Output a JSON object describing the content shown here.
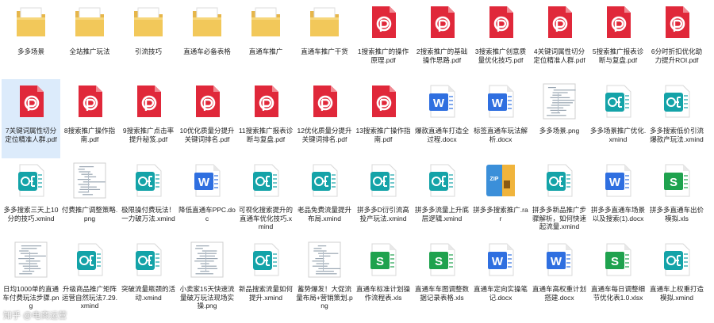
{
  "files": [
    {
      "type": "folder",
      "label": "多多场景"
    },
    {
      "type": "folder",
      "label": "全站推广玩法"
    },
    {
      "type": "folder",
      "label": "引流技巧"
    },
    {
      "type": "folder",
      "label": "直通车必备表格"
    },
    {
      "type": "folder",
      "label": "直通车推广"
    },
    {
      "type": "folder",
      "label": "直通车推广干货"
    },
    {
      "type": "pdf",
      "label": "1搜索推广的操作原理.pdf"
    },
    {
      "type": "pdf",
      "label": "2搜索推广的基础操作思路.pdf"
    },
    {
      "type": "pdf",
      "label": "3搜索推广创意质量优化技巧.pdf"
    },
    {
      "type": "pdf",
      "label": "4关键词属性切分定位精准人群.pdf"
    },
    {
      "type": "pdf",
      "label": "5搜索推广报表诊断与复盘.pdf"
    },
    {
      "type": "pdf",
      "label": "6分时折扣优化助力提升ROI.pdf"
    },
    {
      "type": "pdf",
      "label": "7关键词属性切分定位精准人群.pdf",
      "selected": true
    },
    {
      "type": "pdf",
      "label": "8搜索推广操作指南.pdf"
    },
    {
      "type": "pdf",
      "label": "9搜索推广点击率提升秘笈.pdf"
    },
    {
      "type": "pdf",
      "label": "10优化质量分提升关键词排名.pdf"
    },
    {
      "type": "pdf",
      "label": "11搜索推广报表诊断与复盘.pdf"
    },
    {
      "type": "pdf",
      "label": "12优化质量分提升关键词排名.pdf"
    },
    {
      "type": "pdf",
      "label": "13搜索推广操作指南.pdf"
    },
    {
      "type": "docx",
      "label": "爆款直通车打造全过程.docx"
    },
    {
      "type": "docx",
      "label": "标签直通车玩法解析.docx"
    },
    {
      "type": "png",
      "label": "多多场景.png"
    },
    {
      "type": "xmind",
      "label": "多多场景推广优化.xmind"
    },
    {
      "type": "xmind",
      "label": "多多搜索低价引流爆款产玩法.xmind"
    },
    {
      "type": "xmind",
      "label": "多多搜索三天上10分的技巧.xmind"
    },
    {
      "type": "png",
      "label": "付费推广调整策略.png"
    },
    {
      "type": "xmind",
      "label": "极限操付费玩法！一力破万法.xmind"
    },
    {
      "type": "docx",
      "label": "降低直通车PPC.doc"
    },
    {
      "type": "xmind",
      "label": "可视化搜索提升的直通车优化技巧.xmind"
    },
    {
      "type": "xmind",
      "label": "老品免费流量提升布局.xmind"
    },
    {
      "type": "xmind",
      "label": "拼多多D衍引流高投产玩法.xmind"
    },
    {
      "type": "xmind",
      "label": "拼多多流量上升底层逻辑.xmind"
    },
    {
      "type": "rar",
      "label": "拼多多搜索推广.rar"
    },
    {
      "type": "xmind",
      "label": "拼多多新品推广步骤解析，如何快速起流量.xmind"
    },
    {
      "type": "docx",
      "label": "拼多多直通车场景以及搜索(1).docx"
    },
    {
      "type": "xls",
      "label": "拼多多直通车出价模拟.xls"
    },
    {
      "type": "png",
      "label": "日均1000单的直通车付费玩法步骤.png"
    },
    {
      "type": "xmind",
      "label": "升级商品推广矩阵运营自然玩法7.29.xmind"
    },
    {
      "type": "xmind",
      "label": "突破流量瓶颈的活动.xmind"
    },
    {
      "type": "png",
      "label": "小卖家15天快速流量破万玩法现场实操.png"
    },
    {
      "type": "xmind",
      "label": "新品搜索流量如何提升.xmind"
    },
    {
      "type": "png",
      "label": "蓄势爆发！大促流量布局+营销策划.png"
    },
    {
      "type": "xls",
      "label": "直通车标准计划操作流程表.xls"
    },
    {
      "type": "xls",
      "label": "直通车车图调整数据记录表格.xls"
    },
    {
      "type": "docx",
      "label": "直通车定向实操笔记.docx"
    },
    {
      "type": "docx",
      "label": "直通车高权重计划搭建.docx"
    },
    {
      "type": "xls",
      "label": "直通车每日调整细节优化表1.0.xlsx"
    },
    {
      "type": "xmind",
      "label": "直通车上权重打造模拟.xmind"
    }
  ],
  "icon_text": {
    "word": "W",
    "excel": "S",
    "rar": "ZIP"
  },
  "colors": {
    "pdf": "#e0283a",
    "word": "#2f6fe0",
    "xmind": "#14a3a8",
    "excel": "#1fa24e",
    "folder": "#f2c85a",
    "selected": "#dcebfb"
  },
  "watermark": "知乎 @电商运营"
}
